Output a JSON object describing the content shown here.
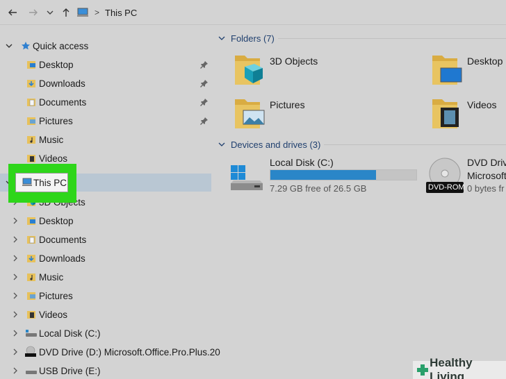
{
  "address_bar": {
    "back_icon": "arrow-left-icon",
    "forward_icon": "arrow-right-icon",
    "recent_icon": "chevron-down-icon",
    "up_icon": "arrow-up-icon",
    "location_icon": "computer-icon",
    "breadcrumb": "This PC"
  },
  "sidebar": {
    "quick_access": {
      "label": "Quick access",
      "items": [
        {
          "label": "Desktop",
          "pinned": true
        },
        {
          "label": "Downloads",
          "pinned": true
        },
        {
          "label": "Documents",
          "pinned": true
        },
        {
          "label": "Pictures",
          "pinned": true
        },
        {
          "label": "Music",
          "pinned": false
        },
        {
          "label": "Videos",
          "pinned": false
        }
      ]
    },
    "this_pc": {
      "label": "This PC",
      "items": [
        {
          "label": "3D Objects"
        },
        {
          "label": "Desktop"
        },
        {
          "label": "Documents"
        },
        {
          "label": "Downloads"
        },
        {
          "label": "Music"
        },
        {
          "label": "Pictures"
        },
        {
          "label": "Videos"
        },
        {
          "label": "Local Disk (C:)"
        },
        {
          "label": "DVD Drive (D:) Microsoft.Office.Pro.Plus.20"
        },
        {
          "label": "USB Drive (E:)"
        }
      ]
    }
  },
  "content": {
    "folders_header": "Folders (7)",
    "folders": [
      {
        "label": "3D Objects"
      },
      {
        "label": "Desktop"
      },
      {
        "label": "Pictures"
      },
      {
        "label": "Videos"
      }
    ],
    "drives_header": "Devices and drives (3)",
    "drives": [
      {
        "label": "Local Disk (C:)",
        "free": "7.29 GB free of 26.5 GB",
        "used_fraction": 0.725
      },
      {
        "label": "DVD Drive",
        "sublabel": "Microsoft",
        "free": "0 bytes fr",
        "badge": "DVD-ROM"
      }
    ]
  },
  "highlight_label": "This PC",
  "watermark": "Healthy Living",
  "colors": {
    "background": "#d3d3d3",
    "selection": "#b9c7d3",
    "highlight": "#2ed61a",
    "drive_bar": "#2a86c8",
    "folder": "#e7c15b"
  }
}
